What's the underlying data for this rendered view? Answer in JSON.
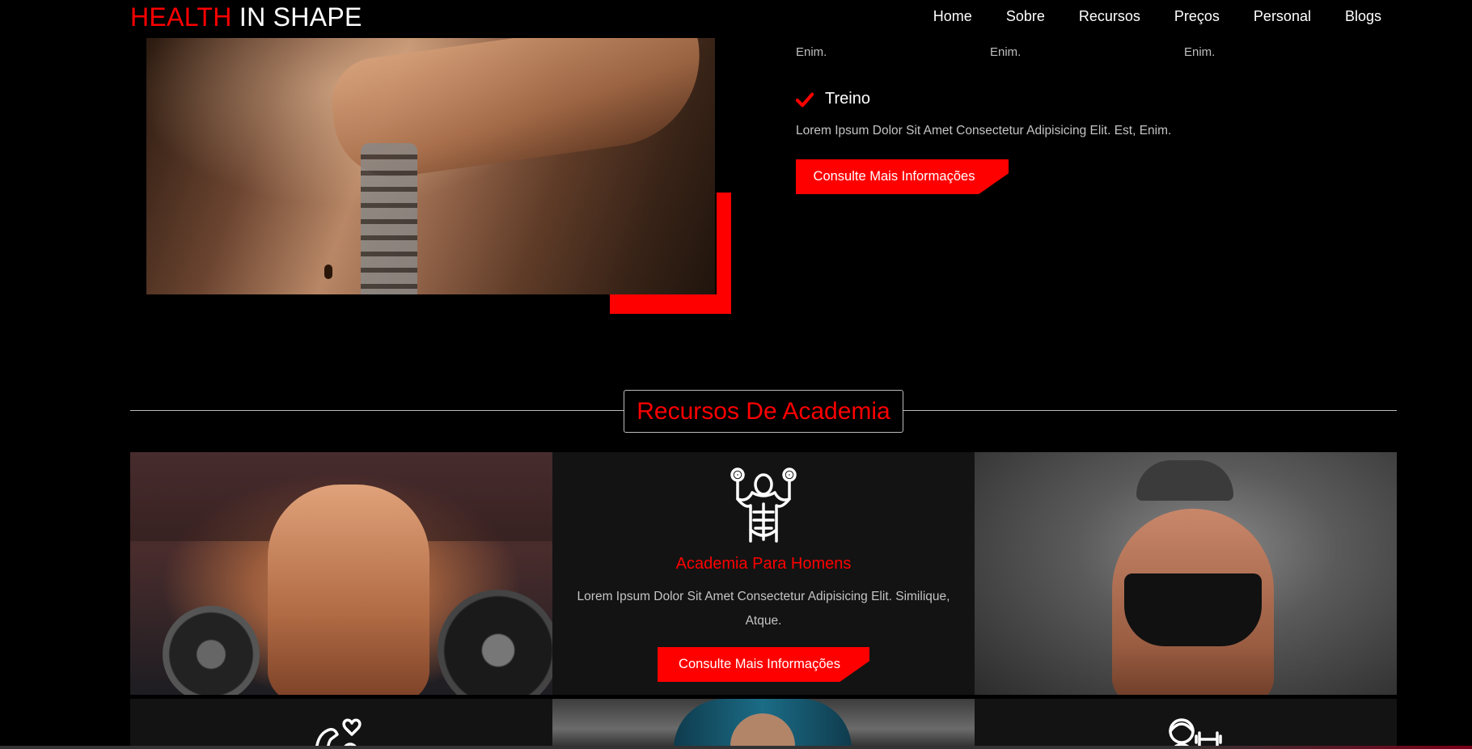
{
  "header": {
    "logo_accent": "HEALTH",
    "logo_rest": " IN SHAPE",
    "nav": [
      "Home",
      "Sobre",
      "Recursos",
      "Preços",
      "Personal",
      "Blogs"
    ]
  },
  "top": {
    "columns": [
      "Enim.",
      "Enim.",
      "Enim."
    ],
    "check_label": "Treino",
    "lorem": "Lorem Ipsum Dolor Sit Amet Consectetur Adipisicing Elit. Est, Enim.",
    "button": "Consulte Mais Informações"
  },
  "section": {
    "title": "Recursos De Academia"
  },
  "card": {
    "icon": "muscle-man-icon",
    "title": "Academia Para Homens",
    "text": "Lorem Ipsum Dolor Sit Amet Consectetur Adipisicing Elit. Similique, Atque.",
    "button": "Consulte Mais Informações"
  },
  "colors": {
    "accent": "#ff0000",
    "background": "#000000",
    "card": "#131313"
  }
}
